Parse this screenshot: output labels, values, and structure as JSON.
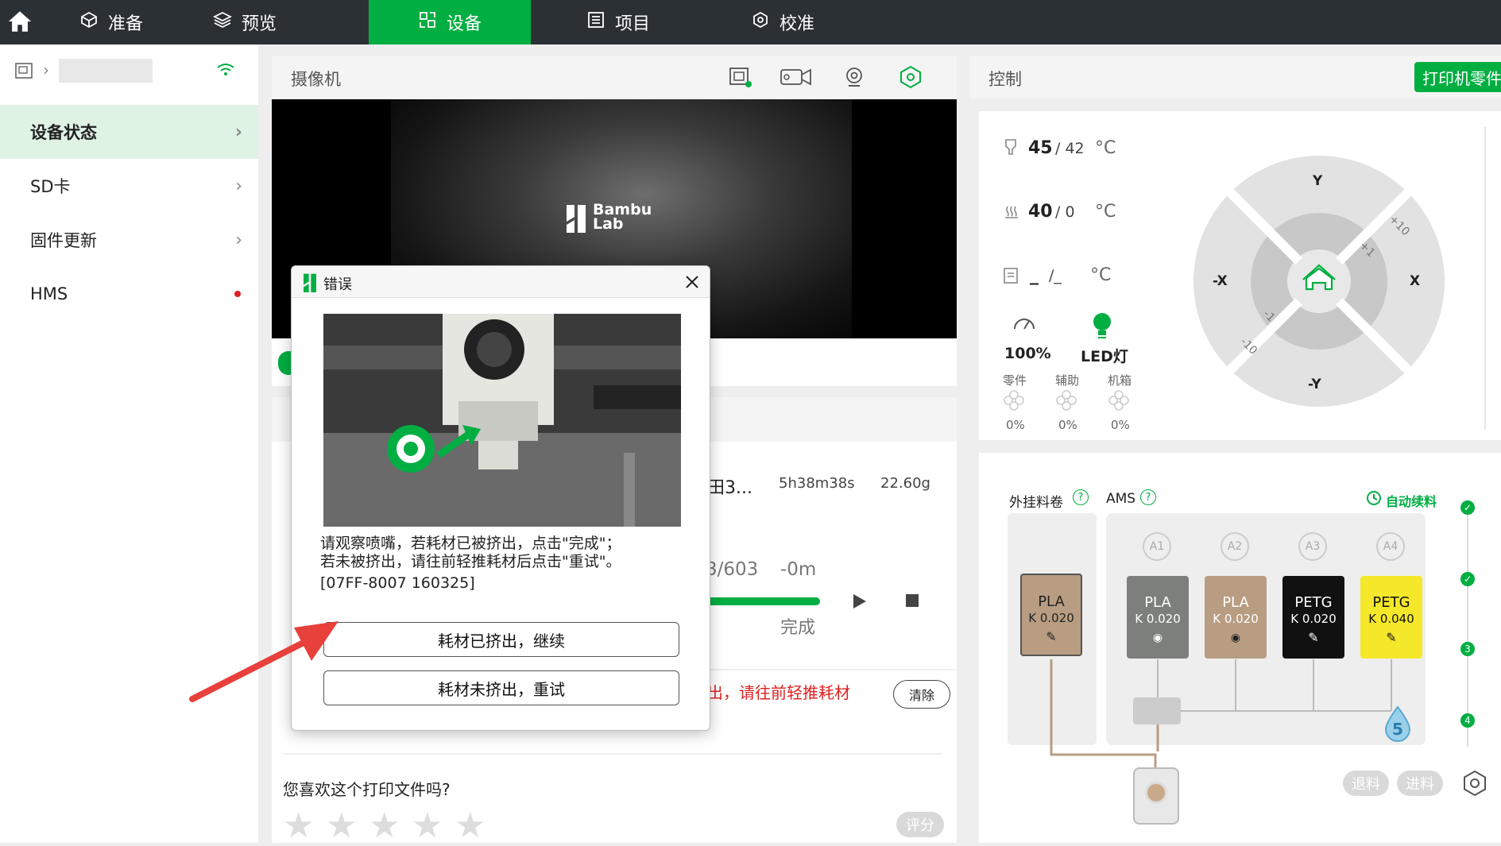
{
  "topbar": {
    "tabs": [
      {
        "label": "准备",
        "icon": "cube-icon"
      },
      {
        "label": "预览",
        "icon": "layers-icon"
      },
      {
        "label": "设备",
        "icon": "device-icon"
      },
      {
        "label": "项目",
        "icon": "list-icon"
      },
      {
        "label": "校准",
        "icon": "calibrate-icon"
      }
    ],
    "active_tab": "设备"
  },
  "sidebar": {
    "items": [
      {
        "label": "设备状态"
      },
      {
        "label": "SD卡"
      },
      {
        "label": "固件更新"
      },
      {
        "label": "HMS"
      }
    ]
  },
  "camera": {
    "title": "摄像机",
    "logo_text": "Bambu Lab"
  },
  "print_job": {
    "name_fragment": "田3...",
    "time": "5h38m38s",
    "weight": "22.60g",
    "layers": "3/603",
    "remaining": "-0m",
    "status": "完成",
    "progress": 1.0,
    "error_fragment": "出，请往前轻推耗材",
    "clear_label": "清除",
    "rate_question": "您喜欢这个打印文件吗?",
    "rate_label": "评分"
  },
  "control": {
    "title": "控制",
    "parts_button": "打印机零件",
    "nozzle_temp": "45",
    "nozzle_target": "/ 42",
    "bed_temp": "40",
    "bed_target": "/ 0",
    "chamber_temp": "_",
    "chamber_target": "/_",
    "unit": "°C",
    "speed": "100%",
    "led_label": "LED灯",
    "fans": [
      {
        "label": "零件",
        "value": "0%"
      },
      {
        "label": "辅助",
        "value": "0%"
      },
      {
        "label": "机箱",
        "value": "0%"
      }
    ],
    "jog": {
      "y_pos": "Y",
      "y_neg": "-Y",
      "x_pos": "X",
      "x_neg": "-X",
      "plus10": "+10",
      "plus1": "+1",
      "minus1": "-1",
      "minus10": "-10"
    }
  },
  "filament": {
    "external_label": "外挂料卷",
    "ams_label": "AMS",
    "auto_refill": "自动续料",
    "external": {
      "type": "PLA",
      "k": "K 0.020",
      "color": "#b89d82"
    },
    "slots": [
      {
        "id": "A1",
        "type": "PLA",
        "k": "K 0.020",
        "color": "#7d7f7c"
      },
      {
        "id": "A2",
        "type": "PLA",
        "k": "K 0.020",
        "color": "#b89d82"
      },
      {
        "id": "A3",
        "type": "PETG",
        "k": "K 0.020",
        "color": "#111111"
      },
      {
        "id": "A4",
        "type": "PETG",
        "k": "K 0.040",
        "color": "#f5e82a"
      }
    ],
    "humidity": "5",
    "unload_label": "退料",
    "load_label": "进料",
    "steps": [
      "3",
      "4"
    ]
  },
  "dialog": {
    "title": "错误",
    "message_line1": "请观察喷嘴，若耗材已被挤出，点击\"完成\"；",
    "message_line2": "若未被挤出，请往前轻推耗材后点击\"重试\"。",
    "code": "[07FF-8007 160325]",
    "btn_continue": "耗材已挤出，继续",
    "btn_retry": "耗材未挤出，重试"
  },
  "colors": {
    "accent": "#00ae42",
    "error": "#e02020",
    "arrow": "#e8403a"
  }
}
